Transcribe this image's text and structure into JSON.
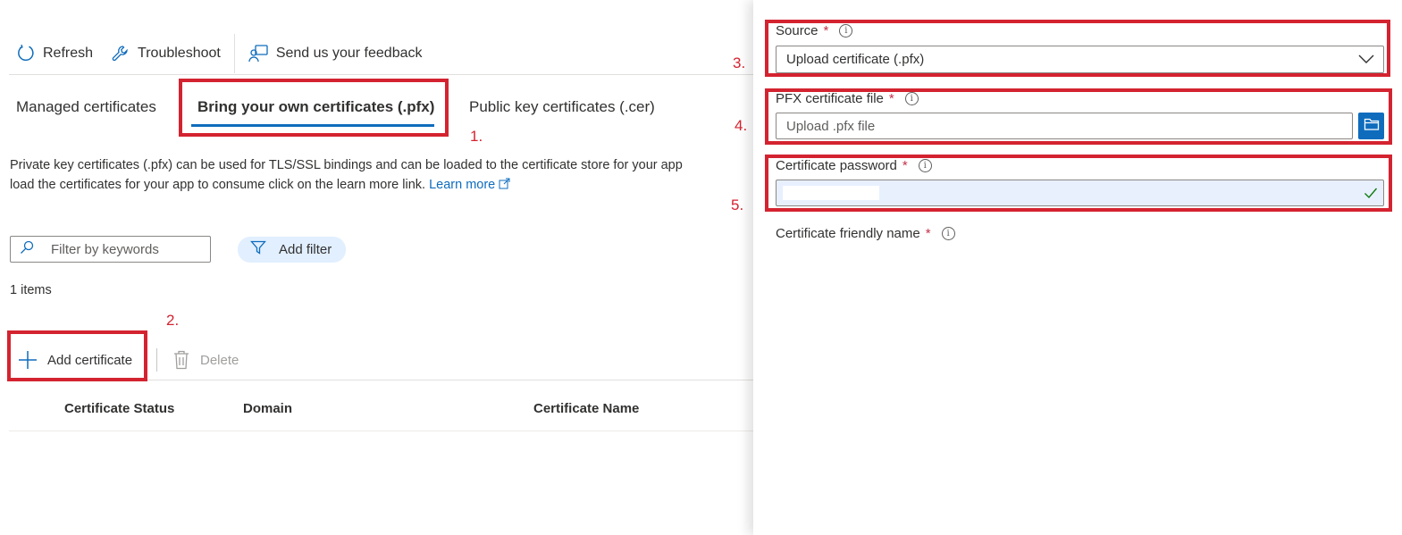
{
  "toolbar": {
    "refresh": "Refresh",
    "troubleshoot": "Troubleshoot",
    "feedback": "Send us your feedback"
  },
  "tabs": [
    {
      "label": "Managed certificates",
      "selected": false
    },
    {
      "label": "Bring your own certificates (.pfx)",
      "selected": true
    },
    {
      "label": "Public key certificates (.cer)",
      "selected": false
    }
  ],
  "description": {
    "line1": "Private key certificates (.pfx) can be used for TLS/SSL bindings and can be loaded to the certificate store for your app",
    "line2": "load the certificates for your app to consume click on the learn more link.",
    "learn_more": "Learn more"
  },
  "filter": {
    "placeholder": "Filter by keywords",
    "add_filter": "Add filter"
  },
  "items_count": "1 items",
  "actions": {
    "add": "Add certificate",
    "delete": "Delete"
  },
  "table": {
    "columns": [
      "Certificate Status",
      "Domain",
      "Certificate Name"
    ]
  },
  "annotations": [
    "1.",
    "2.",
    "3.",
    "4.",
    "5."
  ],
  "panel": {
    "source": {
      "label": "Source",
      "required": "*",
      "value": "Upload certificate (.pfx)"
    },
    "pfx": {
      "label": "PFX certificate file",
      "required": "*",
      "placeholder": "Upload .pfx file"
    },
    "password": {
      "label": "Certificate password",
      "required": "*"
    },
    "friendly": {
      "label": "Certificate friendly name",
      "required": "*"
    }
  },
  "colors": {
    "accent": "#0f6cbd",
    "highlight": "#d42330",
    "pill_bg": "#e1efff",
    "check": "#107c10"
  },
  "icons": {
    "refresh": "refresh-icon",
    "troubleshoot": "wrench-icon",
    "feedback": "feedback-icon",
    "search": "search-icon",
    "filter": "funnel-icon",
    "add": "plus-icon",
    "delete": "trash-icon",
    "external": "external-link-icon",
    "chevron": "chevron-down-icon",
    "folder": "folder-icon",
    "check": "check-icon"
  }
}
